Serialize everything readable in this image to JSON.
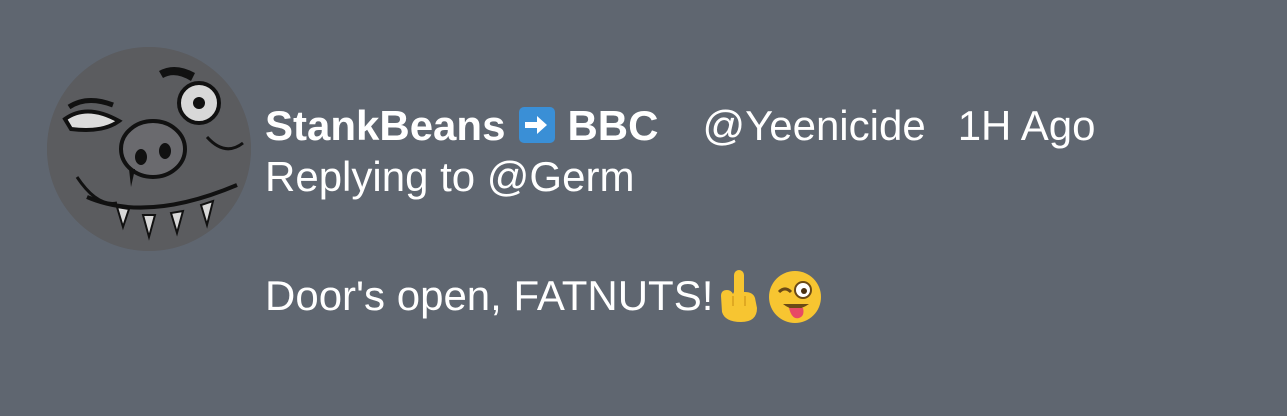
{
  "tweet": {
    "display_name": "StankBeans",
    "badge_icon": "right-arrow-icon",
    "network": "BBC",
    "handle": "@Yeenicide",
    "time": "1H Ago",
    "reply_to": "Replying to @Germ",
    "text": "Door's open, FATNUTS!",
    "emojis": [
      "middle-finger-icon",
      "winking-face-with-tongue-icon"
    ]
  },
  "colors": {
    "background": "#5f6670",
    "text": "#ffffff",
    "badge": "#3a8fd6",
    "emoji_yellow": "#f7c531"
  }
}
